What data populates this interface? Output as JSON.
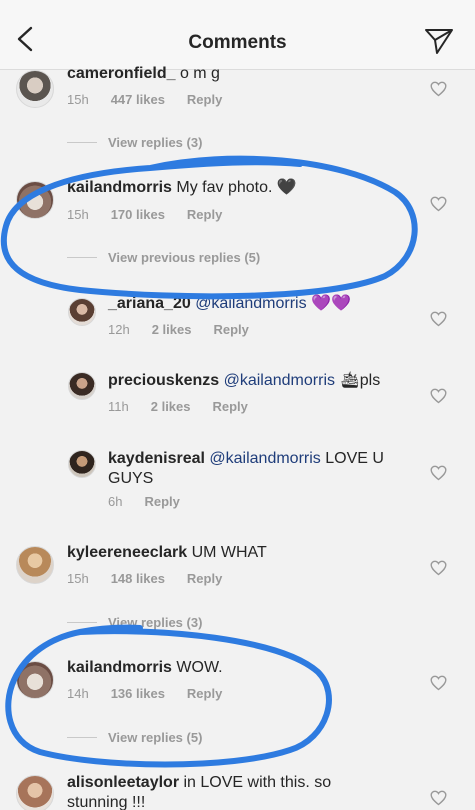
{
  "header": {
    "title": "Comments"
  },
  "comments": [
    {
      "user": "cameronfield_",
      "text": "o m g",
      "time": "15h",
      "likes": "447 likes",
      "reply": "Reply"
    },
    {
      "user": "kailandmorris",
      "text": "My fav photo. 🖤",
      "time": "15h",
      "likes": "170 likes",
      "reply": "Reply"
    },
    {
      "user": "_ariana_20",
      "mention": "@kailandmorris",
      "text": "💜💜",
      "time": "12h",
      "likes": "2 likes",
      "reply": "Reply"
    },
    {
      "user": "preciouskenzs",
      "mention": "@kailandmorris",
      "text": "🛳pls",
      "time": "11h",
      "likes": "2 likes",
      "reply": "Reply"
    },
    {
      "user": "kaydenisreal",
      "mention": "@kailandmorris",
      "text": "LOVE U GUYS",
      "time": "6h",
      "reply": "Reply"
    },
    {
      "user": "kyleereneeclark",
      "text": "UM WHAT",
      "time": "15h",
      "likes": "148 likes",
      "reply": "Reply"
    },
    {
      "user": "kailandmorris",
      "text": "WOW.",
      "time": "14h",
      "likes": "136 likes",
      "reply": "Reply"
    },
    {
      "user": "alisonleetaylor",
      "text": "in LOVE with this. so stunning !!!"
    }
  ],
  "view_replies": [
    "View replies (3)",
    "View previous replies (5)",
    "View replies (3)",
    "View replies (5)"
  ],
  "colors": {
    "annotation": "#2e7be0",
    "background": "#f2f2f2",
    "meta": "#999999"
  }
}
